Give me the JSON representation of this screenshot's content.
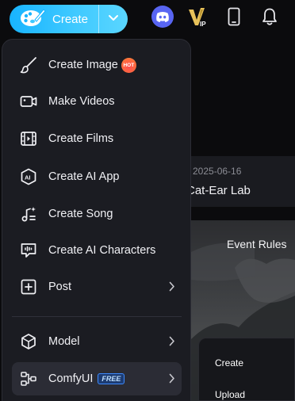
{
  "topbar": {
    "create_label": "Create",
    "icons": [
      "palette-icon",
      "chevron-down-icon",
      "discord-icon",
      "vip-icon",
      "mobile-phone-icon",
      "bell-icon"
    ],
    "brand_color": "#18b4ff",
    "discord_color": "#5865f2",
    "vip_color": "#e8c25a"
  },
  "menu": {
    "items": [
      {
        "label": "Create Image",
        "icon": "brush-icon",
        "badge": "HOT"
      },
      {
        "label": "Make Videos",
        "icon": "video-camera-icon"
      },
      {
        "label": "Create Films",
        "icon": "film-icon"
      },
      {
        "label": "Create AI App",
        "icon": "ai-app-icon"
      },
      {
        "label": "Create Song",
        "icon": "music-note-icon"
      },
      {
        "label": "Create AI Characters",
        "icon": "chat-character-icon"
      },
      {
        "label": "Post",
        "icon": "plus-square-icon",
        "submenu": true
      },
      {
        "label": "Model",
        "icon": "cube-icon",
        "submenu": true
      },
      {
        "label": "ComfyUI",
        "icon": "node-workflow-icon",
        "badge": "FREE",
        "submenu": true,
        "active": true
      }
    ],
    "hot_color": "#ff4f52",
    "free_color": "#3d8bff"
  },
  "background": {
    "card": {
      "date": "2025-06-16",
      "title": "Cat-Ear Lab"
    },
    "hero": {
      "rules_label": "Event Rules"
    },
    "submenu": {
      "items": [
        "Create",
        "Upload"
      ]
    }
  }
}
